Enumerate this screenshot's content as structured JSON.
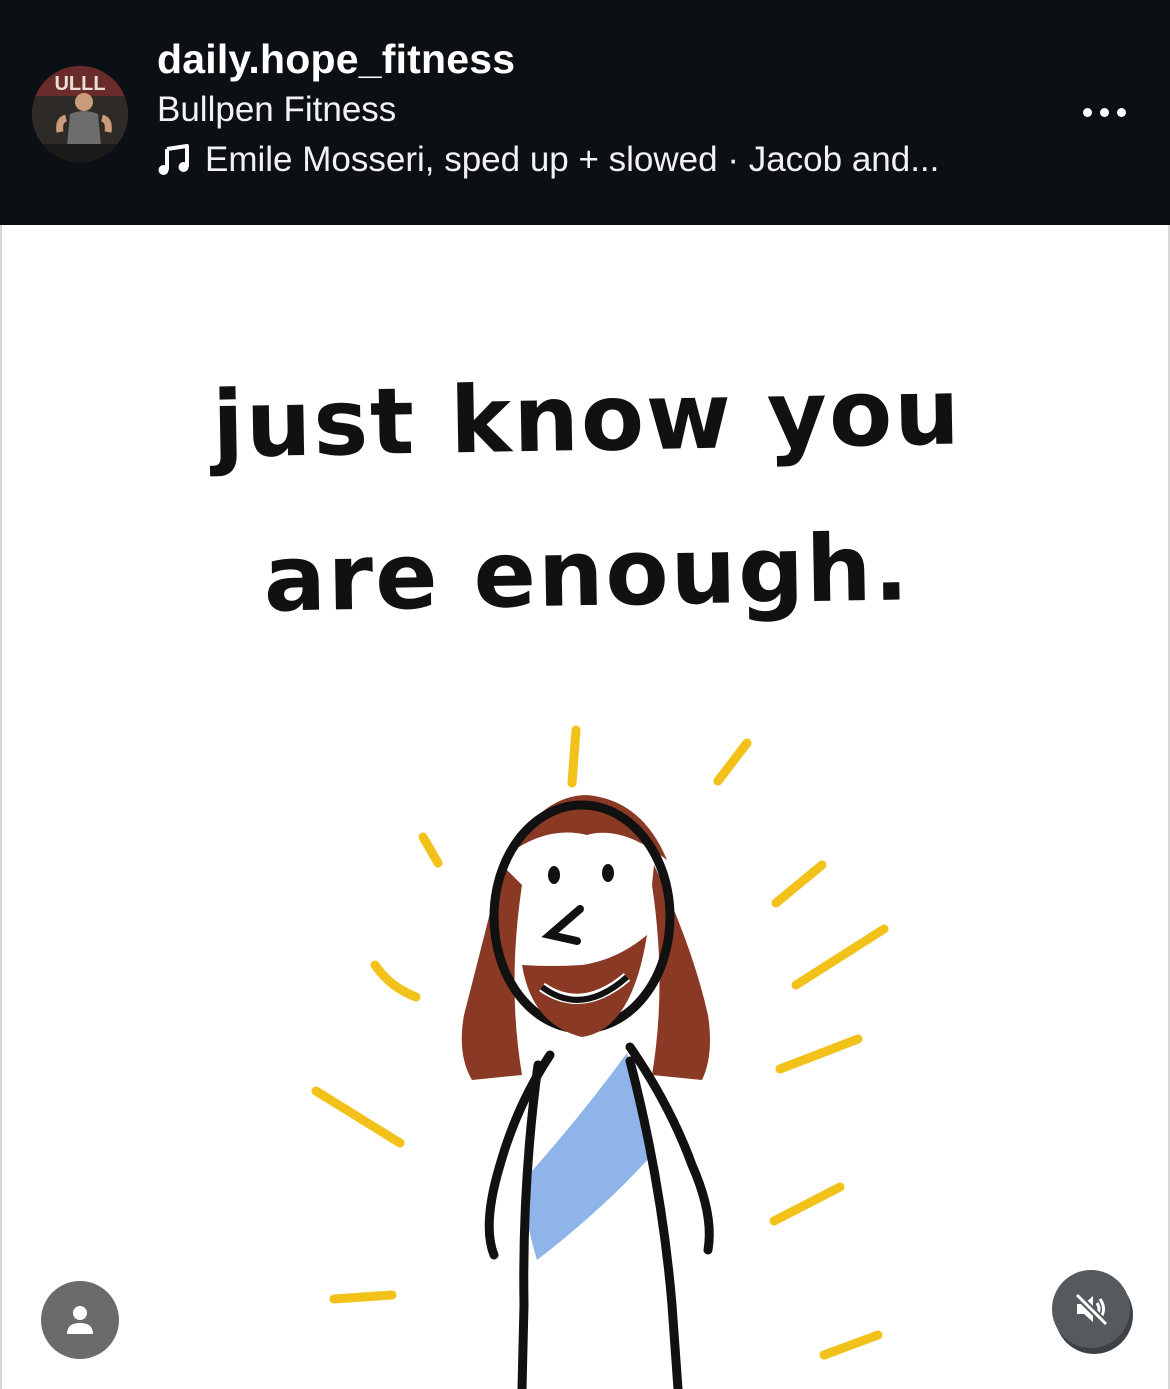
{
  "post": {
    "username": "daily.hope_fitness",
    "location": "Bullpen Fitness",
    "audio": "Emile Mosseri, sped up + slowed · Jacob and...",
    "more_icon": "more-horizontal-icon",
    "music_icon": "music-note-icon"
  },
  "media": {
    "caption_line1": "just know you",
    "caption_line2": "are enough.",
    "tag_icon": "user-tag-icon",
    "mute_icon": "speaker-muted-icon"
  },
  "colors": {
    "header_bg": "#0c0f14",
    "rays": "#f2c21b",
    "hair": "#8a3a24",
    "sash": "#8fb4ea"
  }
}
